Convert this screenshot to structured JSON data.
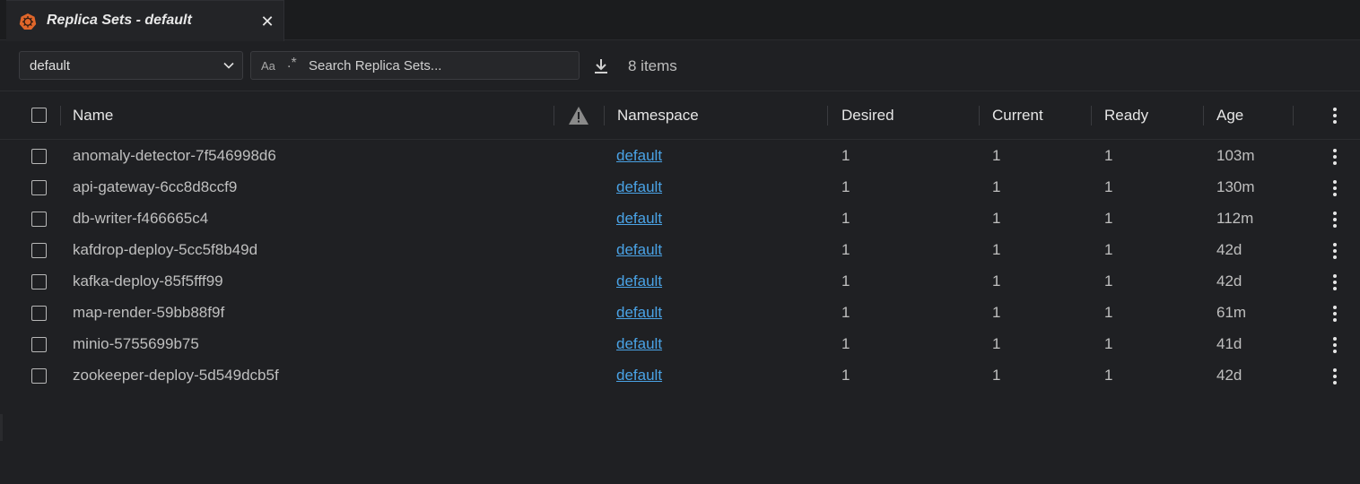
{
  "tab": {
    "title": "Replica Sets - default",
    "close_glyph": "✕",
    "icon": "kubernetes-icon"
  },
  "toolbar": {
    "namespace_value": "default",
    "search_case_label": "Aa",
    "search_regex_label": ".*",
    "search_placeholder": "Search Replica Sets...",
    "items_count": "8 items"
  },
  "table": {
    "columns": {
      "name": "Name",
      "namespace": "Namespace",
      "desired": "Desired",
      "current": "Current",
      "ready": "Ready",
      "age": "Age"
    },
    "rows": [
      {
        "name": "anomaly-detector-7f546998d6",
        "namespace": "default",
        "desired": "1",
        "current": "1",
        "ready": "1",
        "age": "103m"
      },
      {
        "name": "api-gateway-6cc8d8ccf9",
        "namespace": "default",
        "desired": "1",
        "current": "1",
        "ready": "1",
        "age": "130m"
      },
      {
        "name": "db-writer-f466665c4",
        "namespace": "default",
        "desired": "1",
        "current": "1",
        "ready": "1",
        "age": "112m"
      },
      {
        "name": "kafdrop-deploy-5cc5f8b49d",
        "namespace": "default",
        "desired": "1",
        "current": "1",
        "ready": "1",
        "age": "42d"
      },
      {
        "name": "kafka-deploy-85f5fff99",
        "namespace": "default",
        "desired": "1",
        "current": "1",
        "ready": "1",
        "age": "42d"
      },
      {
        "name": "map-render-59bb88f9f",
        "namespace": "default",
        "desired": "1",
        "current": "1",
        "ready": "1",
        "age": "61m"
      },
      {
        "name": "minio-5755699b75",
        "namespace": "default",
        "desired": "1",
        "current": "1",
        "ready": "1",
        "age": "41d"
      },
      {
        "name": "zookeeper-deploy-5d549dcb5f",
        "namespace": "default",
        "desired": "1",
        "current": "1",
        "ready": "1",
        "age": "42d"
      }
    ]
  },
  "colors": {
    "background": "#1f2023",
    "link": "#4aa3e6",
    "tab_icon": "#e0662a"
  }
}
